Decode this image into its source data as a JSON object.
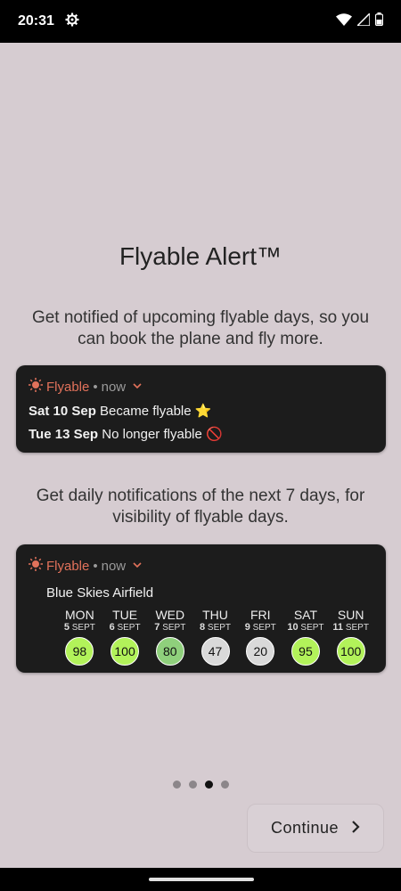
{
  "status_bar": {
    "time": "20:31"
  },
  "onboarding": {
    "title": "Flyable Alert™",
    "description1": "Get notified of upcoming flyable days, so you can book the plane and fly more.",
    "description2": "Get daily notifications of the next 7 days, for visibility of flyable days.",
    "continue_label": "Continue",
    "page_count": 4,
    "current_page": 3
  },
  "notification1": {
    "app_name": "Flyable",
    "separator": "•",
    "time": "now",
    "lines": [
      {
        "date": "Sat 10 Sep",
        "text": "Became flyable ⭐"
      },
      {
        "date": "Tue 13 Sep",
        "text": "No longer flyable 🚫"
      }
    ]
  },
  "notification2": {
    "app_name": "Flyable",
    "separator": "•",
    "time": "now",
    "airfield": "Blue Skies Airfield",
    "days": [
      {
        "name": "MON",
        "day": "5",
        "month": "SEPT",
        "score": "98",
        "color": "#b2f25a"
      },
      {
        "name": "TUE",
        "day": "6",
        "month": "SEPT",
        "score": "100",
        "color": "#b2f25a"
      },
      {
        "name": "WED",
        "day": "7",
        "month": "SEPT",
        "score": "80",
        "color": "#8fd07c"
      },
      {
        "name": "THU",
        "day": "8",
        "month": "SEPT",
        "score": "47",
        "color": "#d9d9d9"
      },
      {
        "name": "FRI",
        "day": "9",
        "month": "SEPT",
        "score": "20",
        "color": "#d9d9d9"
      },
      {
        "name": "SAT",
        "day": "10",
        "month": "SEPT",
        "score": "95",
        "color": "#b2f25a"
      },
      {
        "name": "SUN",
        "day": "11",
        "month": "SEPT",
        "score": "100",
        "color": "#b2f25a"
      }
    ]
  },
  "colors": {
    "background": "#d6ccd1",
    "card": "#1c1c1c",
    "accent": "#e2725b"
  }
}
